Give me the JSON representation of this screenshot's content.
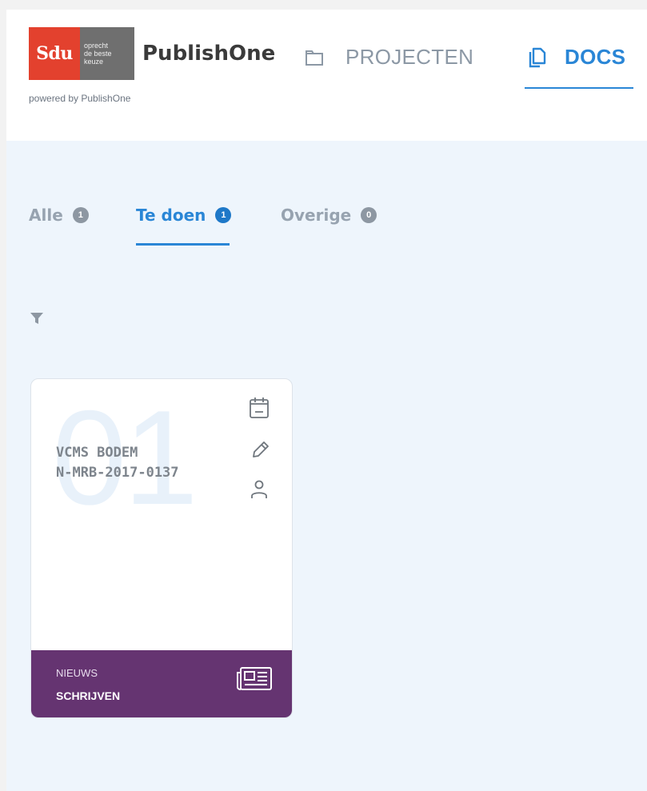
{
  "header": {
    "logo": {
      "mark": "Sdu",
      "tagline": [
        "oprecht",
        "de beste",
        "keuze"
      ]
    },
    "brand": "PublishOne",
    "powered_by": "powered by PublishOne",
    "nav": [
      {
        "label": "PROJECTEN",
        "icon": "folder-icon",
        "active": false
      },
      {
        "label": "DOCS",
        "icon": "documents-icon",
        "active": true
      }
    ]
  },
  "tabs": [
    {
      "label": "Alle",
      "count": "1",
      "active": false
    },
    {
      "label": "Te doen",
      "count": "1",
      "active": true
    },
    {
      "label": "Overige",
      "count": "0",
      "active": false
    }
  ],
  "filter_icon": "filter-icon",
  "cards": [
    {
      "number": "01",
      "title_line1": "VCMS BODEM",
      "title_line2": "N-MRB-2017-0137",
      "icons": [
        "calendar-icon",
        "edit-icon",
        "user-icon"
      ],
      "type": "NIEUWS",
      "status": "SCHRIJVEN",
      "type_icon": "newspaper-icon"
    }
  ],
  "colors": {
    "accent": "#2a86d6",
    "logo_red": "#e3412e",
    "card_footer": "#653471",
    "page_bg": "#eef5fc"
  }
}
